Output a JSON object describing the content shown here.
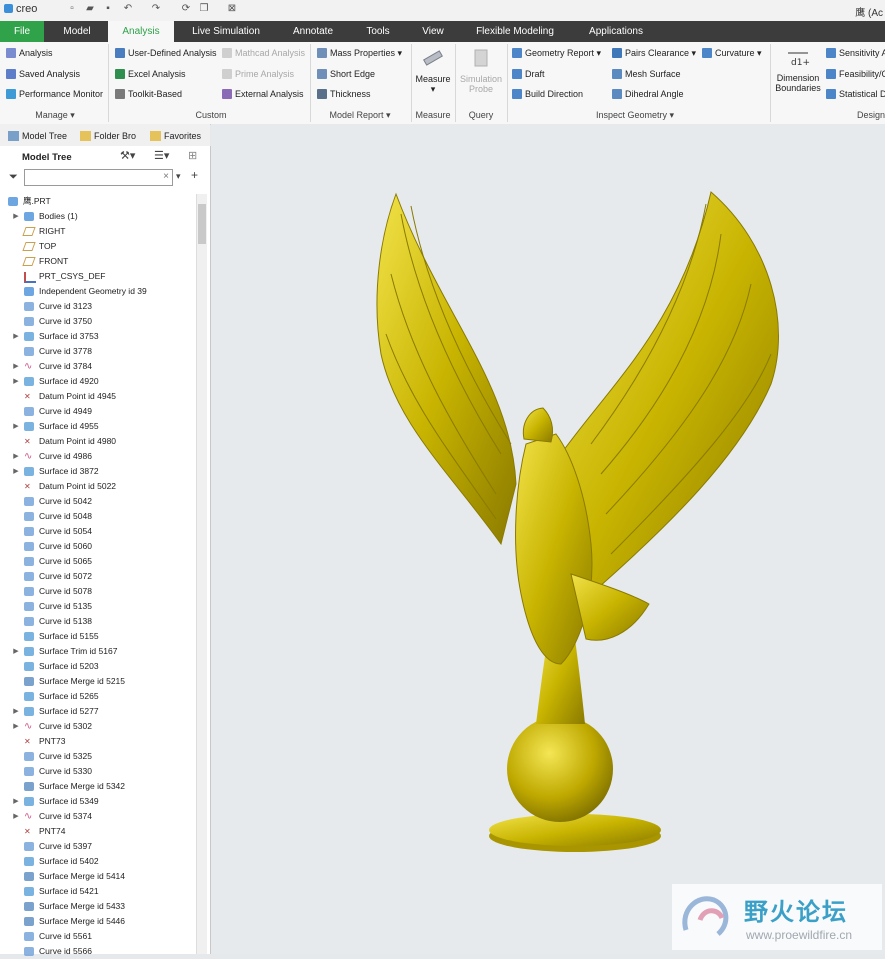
{
  "app": {
    "logo": "creo",
    "window_title": "鹰 (Ac"
  },
  "tabs": [
    {
      "label": "File"
    },
    {
      "label": "Model"
    },
    {
      "label": "Analysis"
    },
    {
      "label": "Live Simulation"
    },
    {
      "label": "Annotate"
    },
    {
      "label": "Tools"
    },
    {
      "label": "View"
    },
    {
      "label": "Flexible Modeling"
    },
    {
      "label": "Applications"
    }
  ],
  "ribbon": {
    "manage": {
      "items": [
        "Analysis",
        "Saved Analysis",
        "Performance Monitor"
      ],
      "group": "Manage"
    },
    "custom": {
      "items": [
        "User-Defined Analysis",
        "Excel Analysis",
        "Toolkit-Based",
        "Mathcad Analysis",
        "Prime Analysis",
        "External Analysis"
      ],
      "group": "Custom"
    },
    "model_report": {
      "items": [
        "Mass Properties",
        "Short Edge",
        "Thickness"
      ],
      "group": "Model Report"
    },
    "measure": {
      "label": "Measure",
      "group": "Measure"
    },
    "query": {
      "label": "Simulation Probe",
      "group": "Query"
    },
    "inspect": {
      "items": [
        "Geometry Report",
        "Draft",
        "Build Direction",
        "Pairs Clearance",
        "Mesh Surface",
        "Dihedral Angle",
        "Curvature"
      ],
      "group": "Inspect Geometry"
    },
    "design": {
      "big": "Dimension Boundaries",
      "items": [
        "Sensitivity A",
        "Feasibility/O",
        "Statistical D"
      ],
      "group": "Design"
    }
  },
  "panel_tabs": [
    "Model Tree",
    "Folder Bro",
    "Favorites"
  ],
  "model_tree": {
    "title": "Model Tree",
    "search_value": "",
    "rows": [
      {
        "label": "鹰.PRT",
        "exp": false,
        "type": "part"
      },
      {
        "label": "Bodies (1)",
        "exp": true,
        "type": "body"
      },
      {
        "label": "RIGHT",
        "exp": false,
        "type": "plane"
      },
      {
        "label": "TOP",
        "exp": false,
        "type": "plane"
      },
      {
        "label": "FRONT",
        "exp": false,
        "type": "plane"
      },
      {
        "label": "PRT_CSYS_DEF",
        "exp": false,
        "type": "csys"
      },
      {
        "label": "Independent Geometry id 39",
        "exp": false,
        "type": "geom"
      },
      {
        "label": "Curve id 3123",
        "exp": false,
        "type": "curve"
      },
      {
        "label": "Curve id 3750",
        "exp": false,
        "type": "curve"
      },
      {
        "label": "Surface id 3753",
        "exp": true,
        "type": "surface"
      },
      {
        "label": "Curve id 3778",
        "exp": false,
        "type": "curve"
      },
      {
        "label": "Curve id 3784",
        "exp": true,
        "type": "curvef"
      },
      {
        "label": "Surface id 4920",
        "exp": true,
        "type": "surface"
      },
      {
        "label": "Datum Point id 4945",
        "exp": false,
        "type": "point"
      },
      {
        "label": "Curve id 4949",
        "exp": false,
        "type": "curve"
      },
      {
        "label": "Surface id 4955",
        "exp": true,
        "type": "surface"
      },
      {
        "label": "Datum Point id 4980",
        "exp": false,
        "type": "point"
      },
      {
        "label": "Curve id 4986",
        "exp": true,
        "type": "curvef"
      },
      {
        "label": "Surface id 3872",
        "exp": true,
        "type": "surface"
      },
      {
        "label": "Datum Point id 5022",
        "exp": false,
        "type": "point"
      },
      {
        "label": "Curve id 5042",
        "exp": false,
        "type": "curve"
      },
      {
        "label": "Curve id 5048",
        "exp": false,
        "type": "curve"
      },
      {
        "label": "Curve id 5054",
        "exp": false,
        "type": "curve"
      },
      {
        "label": "Curve id 5060",
        "exp": false,
        "type": "curve"
      },
      {
        "label": "Curve id 5065",
        "exp": false,
        "type": "curve"
      },
      {
        "label": "Curve id 5072",
        "exp": false,
        "type": "curve"
      },
      {
        "label": "Curve id 5078",
        "exp": false,
        "type": "curve"
      },
      {
        "label": "Curve id 5135",
        "exp": false,
        "type": "curve"
      },
      {
        "label": "Curve id 5138",
        "exp": false,
        "type": "curve"
      },
      {
        "label": "Surface id 5155",
        "exp": false,
        "type": "surface"
      },
      {
        "label": "Surface Trim id 5167",
        "exp": true,
        "type": "surface"
      },
      {
        "label": "Surface id 5203",
        "exp": false,
        "type": "surface"
      },
      {
        "label": "Surface Merge id 5215",
        "exp": false,
        "type": "merge"
      },
      {
        "label": "Surface id 5265",
        "exp": false,
        "type": "surface"
      },
      {
        "label": "Surface id 5277",
        "exp": true,
        "type": "surface"
      },
      {
        "label": "Curve id 5302",
        "exp": true,
        "type": "curvef"
      },
      {
        "label": "PNT73",
        "exp": false,
        "type": "point"
      },
      {
        "label": "Curve id 5325",
        "exp": false,
        "type": "curve"
      },
      {
        "label": "Curve id 5330",
        "exp": false,
        "type": "curve"
      },
      {
        "label": "Surface Merge id 5342",
        "exp": false,
        "type": "merge"
      },
      {
        "label": "Surface id 5349",
        "exp": true,
        "type": "surface"
      },
      {
        "label": "Curve id 5374",
        "exp": true,
        "type": "curvef"
      },
      {
        "label": "PNT74",
        "exp": false,
        "type": "point"
      },
      {
        "label": "Curve id 5397",
        "exp": false,
        "type": "curve"
      },
      {
        "label": "Surface id 5402",
        "exp": false,
        "type": "surface"
      },
      {
        "label": "Surface Merge id 5414",
        "exp": false,
        "type": "merge"
      },
      {
        "label": "Surface id 5421",
        "exp": false,
        "type": "surface"
      },
      {
        "label": "Surface Merge id 5433",
        "exp": false,
        "type": "merge"
      },
      {
        "label": "Surface Merge id 5446",
        "exp": false,
        "type": "merge"
      },
      {
        "label": "Curve id 5561",
        "exp": false,
        "type": "curve"
      },
      {
        "label": "Curve id 5566",
        "exp": false,
        "type": "curve"
      }
    ]
  },
  "watermark": {
    "text": "野火论坛",
    "url": "www.proewildfire.cn"
  },
  "colors": {
    "file_tab": "#2fa24a",
    "tab_bar": "#3c3c3c",
    "model_gold": "#c8b400",
    "viewport": "#e7eaed"
  }
}
